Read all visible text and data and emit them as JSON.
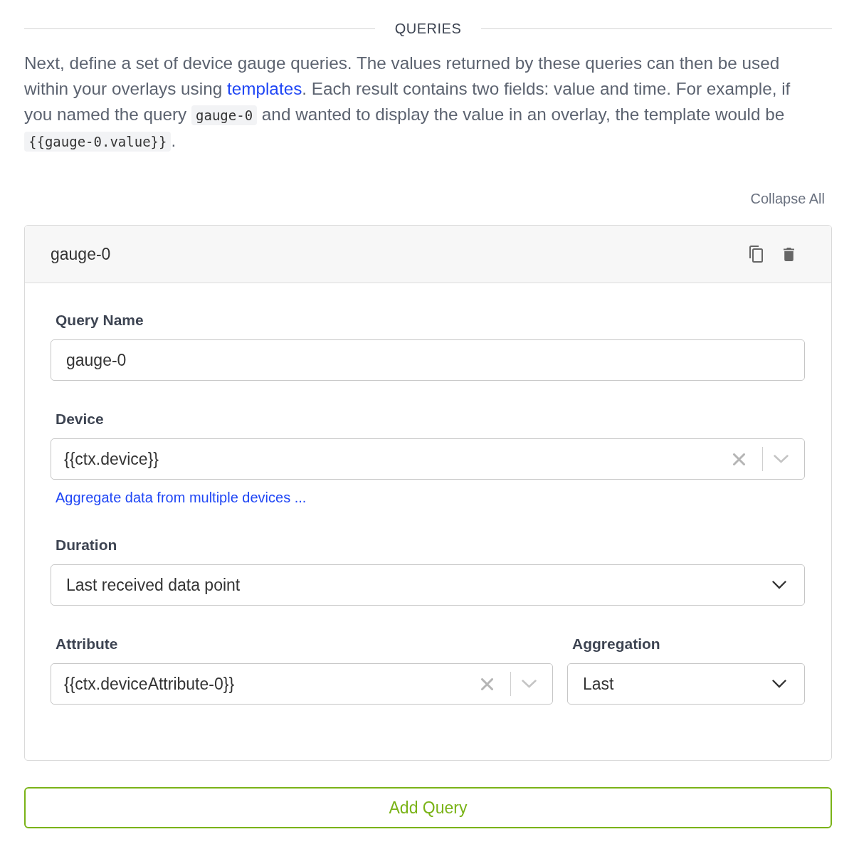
{
  "section": {
    "title": "QUERIES"
  },
  "intro": [
    {
      "kind": "text",
      "text": "Next, define a set of device gauge queries. The values returned by these queries can then be used within your overlays using "
    },
    {
      "kind": "link",
      "text": "templates"
    },
    {
      "kind": "text",
      "text": ". Each result contains two fields: value and time. For example, if you named the query "
    },
    {
      "kind": "code",
      "text": "gauge-0"
    },
    {
      "kind": "text",
      "text": " and wanted to display the value in an overlay, the template would be "
    },
    {
      "kind": "code",
      "text": "{{gauge-0.value}}"
    },
    {
      "kind": "text",
      "text": "."
    }
  ],
  "collapse_all": "Collapse All",
  "queries": [
    {
      "title": "gauge-0",
      "rows": [
        [
          {
            "label": "Query Name",
            "kind": "text",
            "value": "gauge-0"
          }
        ],
        [
          {
            "label": "Device",
            "kind": "combobox",
            "value": "{{ctx.device}}",
            "link": "Aggregate data from multiple devices ..."
          }
        ],
        [
          {
            "label": "Duration",
            "kind": "dropdown",
            "value": "Last received data point"
          }
        ],
        [
          {
            "label": "Attribute",
            "kind": "combobox",
            "value": "{{ctx.deviceAttribute-0}}"
          },
          {
            "label": "Aggregation",
            "kind": "dropdown",
            "value": "Last"
          }
        ]
      ]
    }
  ],
  "add_button": "Add Query"
}
